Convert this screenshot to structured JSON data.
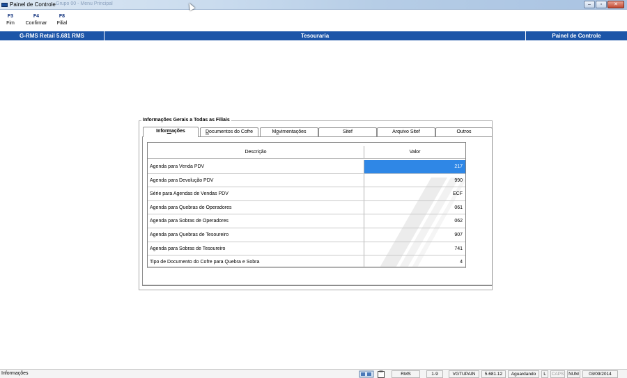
{
  "window": {
    "title": "Painel de Controle",
    "subtitle": "Grupo 00 - Menu Principal",
    "controls": {
      "minimize": "–",
      "maximize": "▫",
      "close": "✕"
    }
  },
  "toolbar": {
    "items": [
      {
        "key": "F3",
        "label": "Fim"
      },
      {
        "key": "F4",
        "label": "Confirmar"
      },
      {
        "key": "F8",
        "label": "Filial"
      }
    ]
  },
  "header": {
    "left": "G-RMS Retail 5.681 RMS",
    "center": "Tesouraria",
    "right": "Painel de Controle"
  },
  "group": {
    "title": "Informações Gerais a Todas as Filiais",
    "tabs": [
      {
        "label": "Informações",
        "active": true
      },
      {
        "label": "Documentos do Cofre",
        "active": false
      },
      {
        "label": "Movimentações",
        "active": false
      },
      {
        "label": "Sitef",
        "active": false
      },
      {
        "label": "Arquivo Sitef",
        "active": false
      },
      {
        "label": "Outros",
        "active": false
      }
    ]
  },
  "grid": {
    "columns": {
      "description": "Descrição",
      "value": "Valor"
    },
    "rows": [
      {
        "description": "Agenda para Venda PDV",
        "value": "217",
        "selected": true
      },
      {
        "description": "Agenda para Devolução PDV",
        "value": "990",
        "selected": false
      },
      {
        "description": "Série para Agendas de Vendas PDV",
        "value": "ECF",
        "selected": false
      },
      {
        "description": "Agenda para Quebras de Operadores",
        "value": "061",
        "selected": false
      },
      {
        "description": "Agenda para Sobras de Operadores",
        "value": "062",
        "selected": false
      },
      {
        "description": "Agenda para Quebras de Tesoureiro",
        "value": "907",
        "selected": false
      },
      {
        "description": "Agenda para Sobras de Tesoureiro",
        "value": "741",
        "selected": false
      },
      {
        "description": "Tipo de Documento do Cofre para Quebra e Sobra",
        "value": "4",
        "selected": false
      }
    ],
    "selection_color": "#2f87e6"
  },
  "statusbar": {
    "left": "Informações",
    "icons": [
      "network-icon",
      "clipboard-icon"
    ],
    "cells": [
      "RMS",
      "1-9",
      "VGTUPAIN",
      "5.681.12",
      "Aguardando",
      "L",
      "CAPS",
      "NUM",
      "03/09/2014"
    ]
  },
  "colors": {
    "header_blue": "#1c55a8",
    "key_blue": "#0b2d7a"
  }
}
